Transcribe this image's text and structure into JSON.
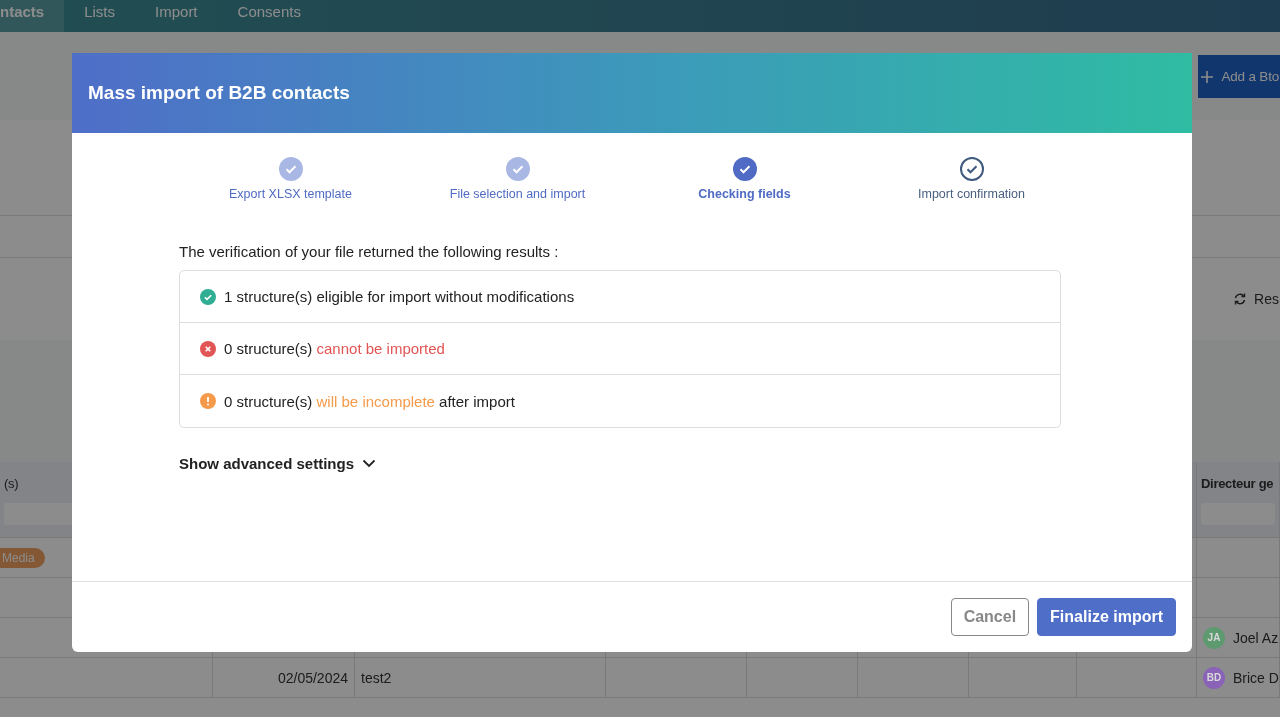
{
  "nav": {
    "tabs": [
      {
        "label": "ntacts",
        "selected": true
      },
      {
        "label": "Lists",
        "selected": false
      },
      {
        "label": "Import",
        "selected": false
      },
      {
        "label": "Consents",
        "selected": false
      }
    ]
  },
  "page": {
    "add_button": "Add a Bto",
    "reset_button": "Res"
  },
  "table": {
    "first_column_header": "(s)",
    "last_column_header": "Directeur ge",
    "rows": [
      {
        "tag": "Media"
      },
      {},
      {
        "owner": {
          "initials": "JA",
          "name": "Joel Az",
          "color": "#5e9a70"
        }
      },
      {
        "date": "02/05/2024",
        "text": "test2",
        "owner": {
          "initials": "BD",
          "name": "Brice D",
          "color": "#8a62b8"
        }
      }
    ]
  },
  "modal": {
    "title": "Mass import of B2B contacts",
    "steps": [
      {
        "label": "Export XLSX template",
        "kind": "done"
      },
      {
        "label": "File selection and import",
        "kind": "done"
      },
      {
        "label": "Checking fields",
        "kind": "current"
      },
      {
        "label": "Import confirmation",
        "kind": "pending"
      }
    ],
    "intro": "The verification of your file returned the following results :",
    "results": [
      {
        "kind": "success",
        "prefix": "1 structure(s) eligible for import without modifications"
      },
      {
        "kind": "error",
        "prefix": "0 structure(s) ",
        "highlight": "cannot be imported"
      },
      {
        "kind": "warning",
        "prefix": "0 structure(s) ",
        "highlight": "will be incomplete",
        "suffix": " after import"
      }
    ],
    "advanced_toggle": {
      "label": "Show advanced settings",
      "expanded": false
    },
    "buttons": {
      "cancel": "Cancel",
      "confirm": "Finalize import"
    }
  }
}
